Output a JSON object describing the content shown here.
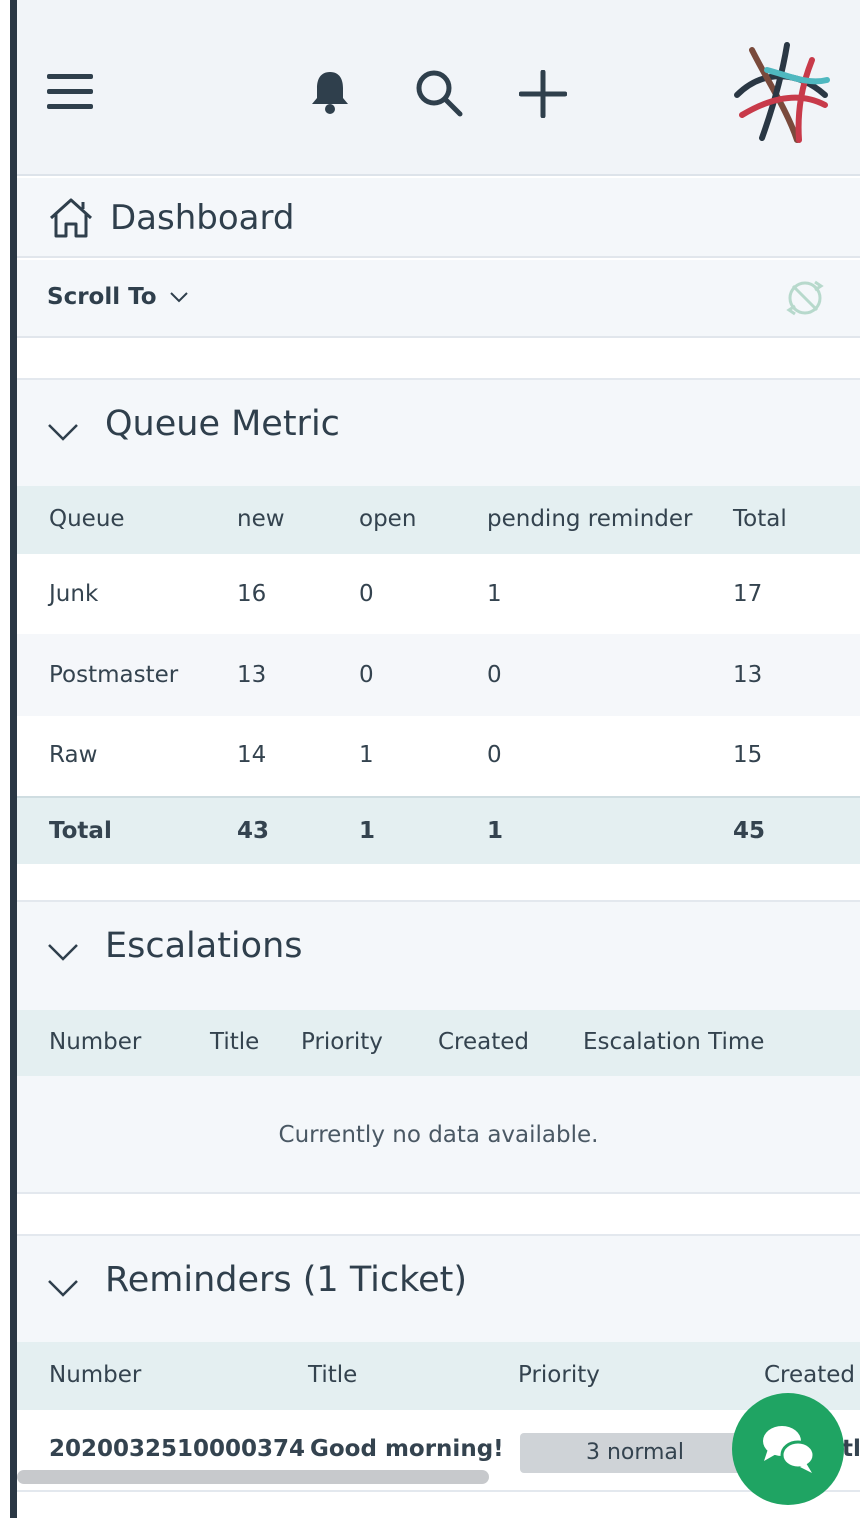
{
  "breadcrumb": {
    "title": "Dashboard"
  },
  "scroll_to": {
    "label": "Scroll To"
  },
  "queue_metric": {
    "title": "Queue Metric",
    "headers": [
      "Queue",
      "new",
      "open",
      "pending reminder",
      "Total"
    ],
    "rows": [
      [
        "Junk",
        "16",
        "0",
        "1",
        "17"
      ],
      [
        "Postmaster",
        "13",
        "0",
        "0",
        "13"
      ],
      [
        "Raw",
        "14",
        "1",
        "0",
        "15"
      ]
    ],
    "total": [
      "Total",
      "43",
      "1",
      "1",
      "45"
    ]
  },
  "escalations": {
    "title": "Escalations",
    "headers": [
      "Number",
      "Title",
      "Priority",
      "Created",
      "Escalation Time"
    ],
    "empty": "Currently no data available."
  },
  "reminders": {
    "title": "Reminders (1 Ticket)",
    "headers": [
      "Number",
      "Title",
      "Priority",
      "Created"
    ],
    "row": {
      "number": "2020032510000374",
      "title": "Good morning!",
      "priority": "3 normal",
      "clipped": "tl"
    }
  },
  "colors": {
    "accent": "#1fa463",
    "table_header": "#e4eff1",
    "sidebar": "#2a3744"
  },
  "icons": [
    "menu-icon",
    "bell-icon",
    "search-icon",
    "plus-icon",
    "logo-icon",
    "home-icon",
    "chevron-down-icon",
    "refresh-icon",
    "chat-icon"
  ]
}
